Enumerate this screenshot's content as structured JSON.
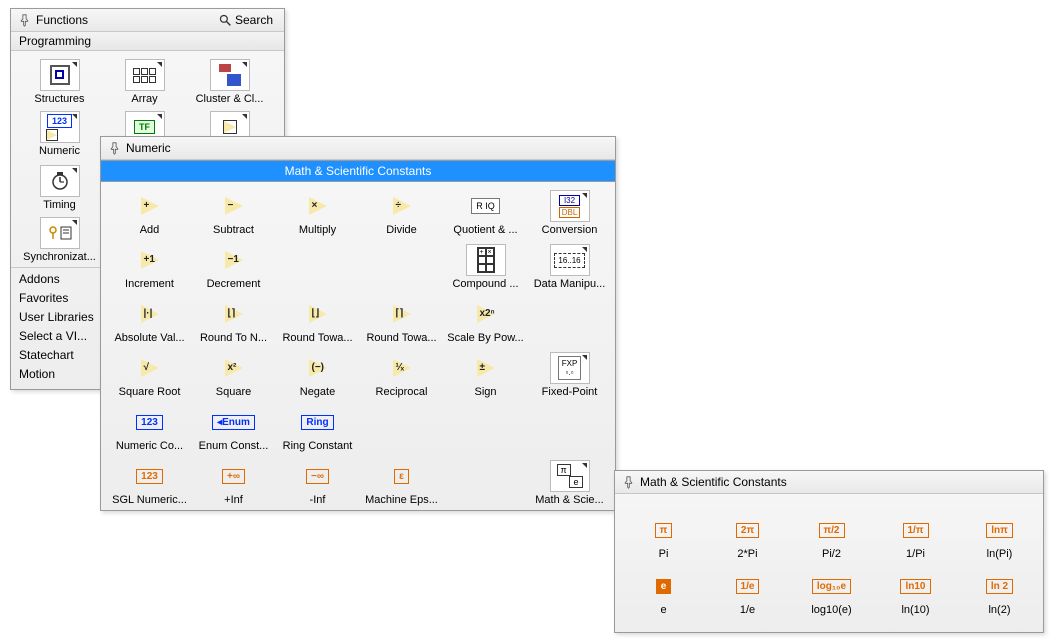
{
  "functions": {
    "title": "Functions",
    "search_label": "Search",
    "section": "Programming",
    "items": [
      {
        "label": "Structures"
      },
      {
        "label": "Array"
      },
      {
        "label": "Cluster & Cl..."
      },
      {
        "label": "Numeric"
      },
      {
        "label": "Timing"
      },
      {
        "label": "Synchronizat..."
      }
    ],
    "categories": [
      "Addons",
      "Favorites",
      "User Libraries",
      "Select a VI...",
      "Statechart",
      "Motion"
    ]
  },
  "numeric": {
    "title": "Numeric",
    "banner": "Math & Scientific Constants",
    "rows": [
      [
        {
          "label": "Add",
          "sym": "+"
        },
        {
          "label": "Subtract",
          "sym": "−"
        },
        {
          "label": "Multiply",
          "sym": "×"
        },
        {
          "label": "Divide",
          "sym": "÷"
        },
        {
          "label": "Quotient & ...",
          "chip": "R IQ"
        },
        {
          "label": "Conversion",
          "dbl": true
        }
      ],
      [
        {
          "label": "Increment",
          "sym": "+1"
        },
        {
          "label": "Decrement",
          "sym": "−1"
        },
        {
          "label": ""
        },
        {
          "label": ""
        },
        {
          "label": "Compound ...",
          "grid": true
        },
        {
          "label": "Data Manipu...",
          "dm": true
        }
      ],
      [
        {
          "label": "Absolute Val...",
          "sym": "|·|"
        },
        {
          "label": "Round To N...",
          "sym": "⌊⌉"
        },
        {
          "label": "Round Towa...",
          "sym": "⌊⌋"
        },
        {
          "label": "Round Towa...",
          "sym": "⌈⌉"
        },
        {
          "label": "Scale By Pow...",
          "sym": "x2ⁿ"
        }
      ],
      [
        {
          "label": "Square Root",
          "sym": "√"
        },
        {
          "label": "Square",
          "sym": "x²"
        },
        {
          "label": "Negate",
          "sym": "(−)"
        },
        {
          "label": "Reciprocal",
          "sym": "¹⁄ₓ"
        },
        {
          "label": "Sign",
          "sym": "±"
        },
        {
          "label": "Fixed-Point",
          "fxp": true
        }
      ],
      [
        {
          "label": "Numeric Co...",
          "chipText": "123",
          "chipClass": "blue"
        },
        {
          "label": "Enum Const...",
          "chipText": "◂Enum",
          "chipClass": "blue"
        },
        {
          "label": "Ring Constant",
          "chipText": "Ring",
          "chipClass": "blue"
        }
      ],
      [
        {
          "label": "SGL Numeric...",
          "chipText": "123",
          "chipClass": "orange"
        },
        {
          "label": "+Inf",
          "chipText": "+∞",
          "chipClass": "orange"
        },
        {
          "label": "-Inf",
          "chipText": "−∞",
          "chipClass": "orange"
        },
        {
          "label": "Machine Eps...",
          "chipText": "ε",
          "chipClass": "orange"
        },
        {
          "label": ""
        },
        {
          "label": "Math & Scie...",
          "msc": true
        }
      ]
    ]
  },
  "constants": {
    "title": "Math & Scientific Constants",
    "rows": [
      [
        {
          "label": "Pi",
          "chip": "π"
        },
        {
          "label": "2*Pi",
          "chip": "2π"
        },
        {
          "label": "Pi/2",
          "chip": "π/2"
        },
        {
          "label": "1/Pi",
          "chip": "1/π"
        },
        {
          "label": "ln(Pi)",
          "chip": "lnπ"
        }
      ],
      [
        {
          "label": "e",
          "chip": "e",
          "fill": true
        },
        {
          "label": "1/e",
          "chip": "1/e"
        },
        {
          "label": "log10(e)",
          "chip": "log₁₀e"
        },
        {
          "label": "ln(10)",
          "chip": "ln10"
        },
        {
          "label": "ln(2)",
          "chip": "ln 2"
        }
      ]
    ]
  }
}
